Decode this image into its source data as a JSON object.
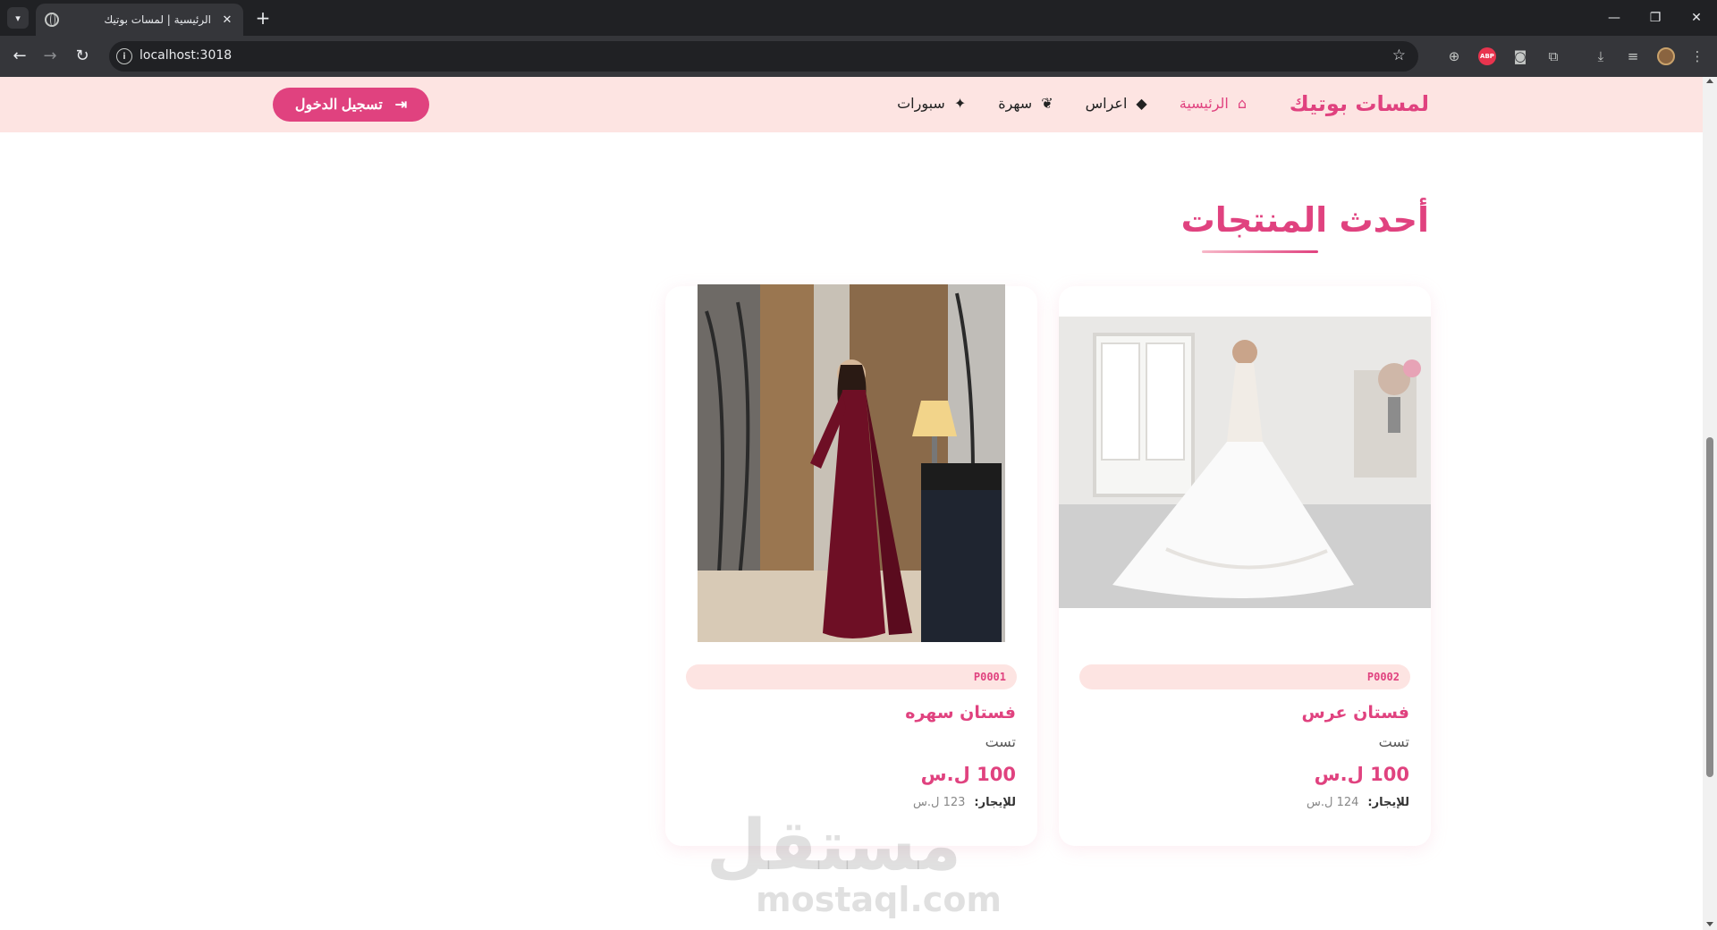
{
  "browser": {
    "tab_title": "الرئيسية | لمسات بوتيك",
    "url": "localhost:3018"
  },
  "site": {
    "brand": "لمسات بوتيك",
    "nav": [
      {
        "label": "الرئيسية",
        "icon": "home-icon",
        "active": true
      },
      {
        "label": "اعراس",
        "icon": "diamond-icon",
        "active": false
      },
      {
        "label": "سهرة",
        "icon": "leaf-icon",
        "active": false
      },
      {
        "label": "سبورات",
        "icon": "running-icon",
        "active": false
      }
    ],
    "login_label": "تسجيل الدخول"
  },
  "section": {
    "title": "أحدث المنتجات"
  },
  "products": [
    {
      "code": "P0002",
      "name": "فستان عرس",
      "description": "تست",
      "price": "100 ل.س",
      "rent_label": "للإيجار:",
      "rent_value": "124 ل.س"
    },
    {
      "code": "P0001",
      "name": "فستان سهره",
      "description": "تست",
      "price": "100 ل.س",
      "rent_label": "للإيجار:",
      "rent_value": "123 ل.س"
    }
  ],
  "watermark": {
    "arabic": "مستقل",
    "latin": "mostaql.com"
  },
  "scroll": {
    "position_fraction": 0.45
  },
  "colors": {
    "accent": "#e0427f",
    "navbar_bg": "#fde4e2",
    "chrome_dark": "#202124",
    "chrome_toolbar": "#35363a"
  }
}
